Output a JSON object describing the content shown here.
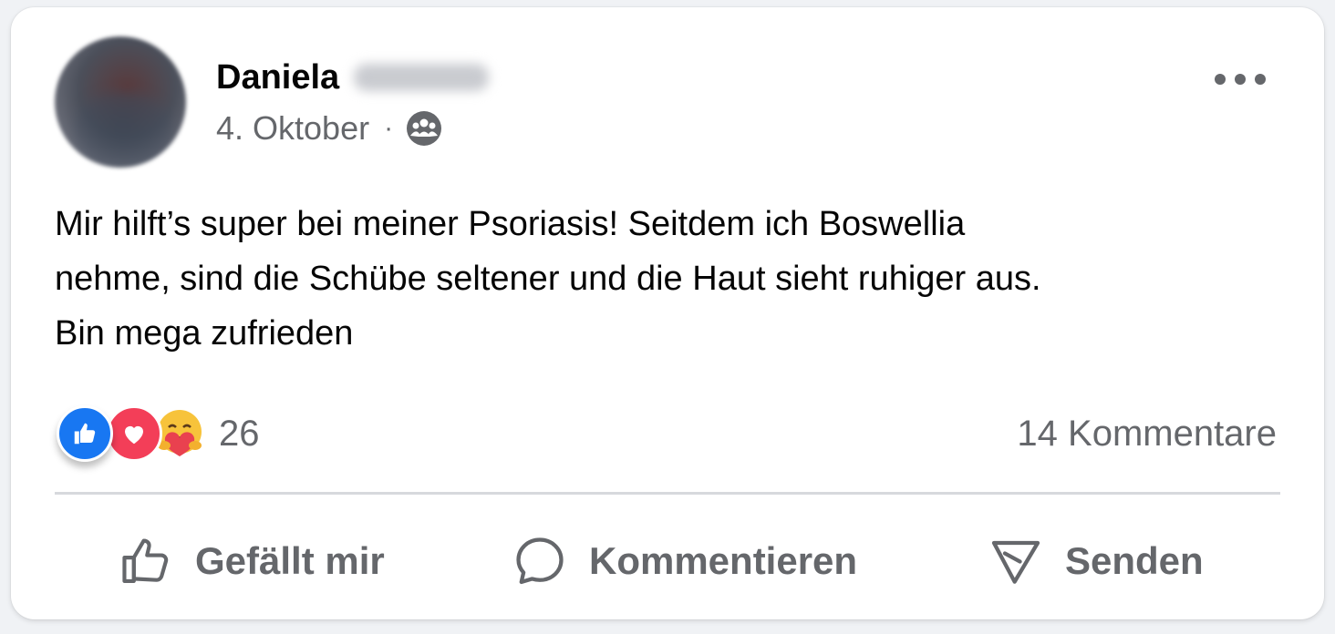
{
  "post": {
    "author_first_name": "Daniela",
    "date": "4. Oktober",
    "separator": "·",
    "audience_icon": "group-icon",
    "more_icon": "more-options-icon",
    "text": "Mir hilft’s super bei meiner Psoriasis! Seitdem ich Boswellia\nnehme, sind die Schübe seltener und die Haut sieht ruhiger aus.\nBin mega zufrieden"
  },
  "reactions": {
    "icons": [
      "like-reaction-icon",
      "love-reaction-icon",
      "care-reaction-icon"
    ],
    "count": "26"
  },
  "comments": {
    "label": "14 Kommentare"
  },
  "actions": {
    "like_label": "Gefällt mir",
    "comment_label": "Kommentieren",
    "send_label": "Senden"
  },
  "colors": {
    "like_blue": "#1877f2",
    "love_red": "#f33e58",
    "secondary_text": "#65676b"
  }
}
